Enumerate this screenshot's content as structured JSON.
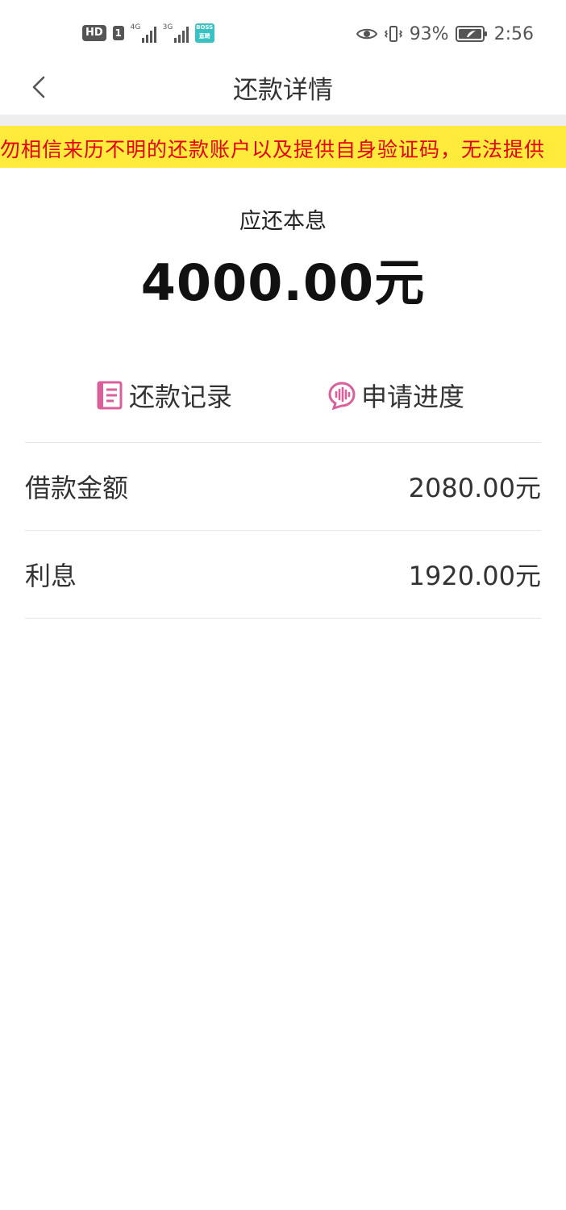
{
  "status_bar": {
    "hd": "HD",
    "sim": "1",
    "net1": "4G",
    "net2": "3G",
    "boss_app": "BOSS\n直聘",
    "battery": "93%",
    "time": "2:56"
  },
  "nav": {
    "back_icon": "chevron-left",
    "title": "还款详情"
  },
  "notice": {
    "text": "勿相信来历不明的还款账户以及提供自身验证码，无法提供",
    "color": "#e60012",
    "background": "#ffeb3b"
  },
  "amount": {
    "label": "应还本息",
    "value": "4000.00元"
  },
  "actions": [
    {
      "label": "还款记录",
      "icon": "document-icon"
    },
    {
      "label": "申请进度",
      "icon": "progress-bubble-icon"
    }
  ],
  "accent": "#d9609b",
  "details": [
    {
      "key": "借款金额",
      "value": "2080.00元"
    },
    {
      "key": "利息",
      "value": "1920.00元"
    }
  ]
}
